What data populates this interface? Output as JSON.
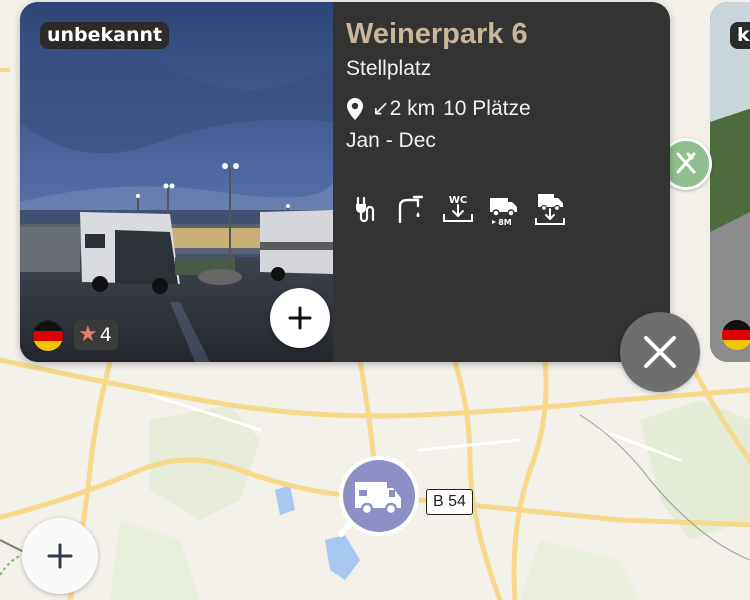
{
  "card": {
    "badge": "unbekannt",
    "title": "Weinerpark 6",
    "type": "Stellplatz",
    "distance": "↙2 km",
    "places": "10 Plätze",
    "season_from": "Jan -",
    "season_to": "Dec",
    "rating": "4",
    "country_flag": "germany-flag",
    "amenities": [
      "power-plug-icon",
      "water-tap-icon",
      "wc-dump-icon",
      "max-length-8m-icon",
      "grey-water-dump-icon"
    ],
    "amenity_labels": {
      "wc": "WC",
      "length": "8M"
    }
  },
  "next_card": {
    "badge": "k"
  },
  "map": {
    "road_label": "B 54"
  },
  "colors": {
    "card_bg": "#333333",
    "title": "#c8b69a",
    "pin": "#8e8fc6",
    "food_pin": "#8fbf8f"
  }
}
